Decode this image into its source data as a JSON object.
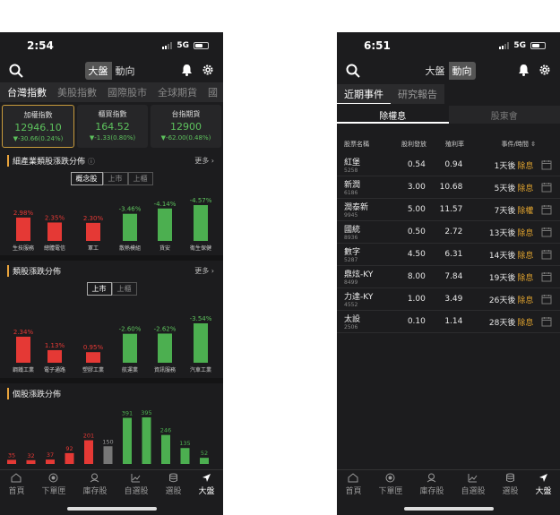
{
  "left": {
    "status": {
      "time": "2:54",
      "network": "5G"
    },
    "segment": [
      "大盤",
      "動向"
    ],
    "tabs": [
      "台灣指數",
      "美股指數",
      "國際股市",
      "全球期貨",
      "國"
    ],
    "indices": [
      {
        "name": "加權指數",
        "price": "12946.10",
        "change": "▼-30.66(0.24%)"
      },
      {
        "name": "櫃買指數",
        "price": "164.52",
        "change": "▼-1.33(0.80%)"
      },
      {
        "name": "台指期貨",
        "price": "12900",
        "change": "▼-62.00(0.48%)"
      }
    ],
    "sec1": {
      "title": "細產業類股漲跌分佈",
      "more": "更多",
      "seg": [
        "概念股",
        "上市",
        "上櫃"
      ],
      "bars": [
        {
          "label": "2.98%",
          "value": 2.98,
          "name": "生技服務"
        },
        {
          "label": "2.35%",
          "value": 2.35,
          "name": "總體電信"
        },
        {
          "label": "2.30%",
          "value": 2.3,
          "name": "軍工"
        },
        {
          "label": "-3.46%",
          "value": -3.46,
          "name": "散熱模組"
        },
        {
          "label": "-4.14%",
          "value": -4.14,
          "name": "貨安"
        },
        {
          "label": "-4.57%",
          "value": -4.57,
          "name": "衛生保健"
        }
      ]
    },
    "sec2": {
      "title": "類股漲跌分佈",
      "more": "更多",
      "seg": [
        "上市",
        "上櫃"
      ],
      "bars": [
        {
          "label": "2.34%",
          "value": 2.34,
          "name": "鋼鐵工業"
        },
        {
          "label": "1.13%",
          "value": 1.13,
          "name": "電子通路"
        },
        {
          "label": "0.95%",
          "value": 0.95,
          "name": "塑膠工業"
        },
        {
          "label": "-2.60%",
          "value": -2.6,
          "name": "航運業"
        },
        {
          "label": "-2.62%",
          "value": -2.62,
          "name": "資訊服務"
        },
        {
          "label": "-3.54%",
          "value": -3.54,
          "name": "汽車工業"
        }
      ]
    },
    "sec3": {
      "title": "個股漲跌分佈",
      "bars": [
        35,
        32,
        37,
        92,
        201,
        150,
        391,
        395,
        246,
        135,
        52
      ],
      "bar_colors": [
        "#e53935",
        "#e53935",
        "#e53935",
        "#e53935",
        "#e53935",
        "#777777",
        "#4caf50",
        "#4caf50",
        "#4caf50",
        "#4caf50",
        "#4caf50"
      ]
    },
    "nav": [
      "首頁",
      "下單匣",
      "庫存股",
      "自選股",
      "選股",
      "大盤"
    ]
  },
  "right": {
    "status": {
      "time": "6:51",
      "network": "5G"
    },
    "segment": [
      "大盤",
      "動向"
    ],
    "tabs": [
      "近期事件",
      "研究報告"
    ],
    "subtabs": [
      "除權息",
      "股東會"
    ],
    "headers": [
      "股票名稱",
      "股利發放",
      "殖利率",
      "事件/時間 ⇳"
    ],
    "rows": [
      {
        "name": "紅堡",
        "code": "5258",
        "div": "0.54",
        "yld": "0.94",
        "days": "1天後",
        "event": "除息"
      },
      {
        "name": "新潤",
        "code": "6186",
        "div": "3.00",
        "yld": "10.68",
        "days": "5天後",
        "event": "除息"
      },
      {
        "name": "潤泰新",
        "code": "9945",
        "div": "5.00",
        "yld": "11.57",
        "days": "7天後",
        "event": "除權"
      },
      {
        "name": "國統",
        "code": "8936",
        "div": "0.50",
        "yld": "2.72",
        "days": "13天後",
        "event": "除息"
      },
      {
        "name": "數字",
        "code": "5287",
        "div": "4.50",
        "yld": "6.31",
        "days": "14天後",
        "event": "除息"
      },
      {
        "name": "鼎炫-KY",
        "code": "8499",
        "div": "8.00",
        "yld": "7.84",
        "days": "19天後",
        "event": "除息"
      },
      {
        "name": "力達-KY",
        "code": "4552",
        "div": "1.00",
        "yld": "3.49",
        "days": "26天後",
        "event": "除息"
      },
      {
        "name": "太設",
        "code": "2506",
        "div": "0.10",
        "yld": "1.14",
        "days": "28天後",
        "event": "除息"
      }
    ],
    "nav": [
      "首頁",
      "下單匣",
      "庫存股",
      "自選股",
      "選股",
      "大盤"
    ]
  }
}
